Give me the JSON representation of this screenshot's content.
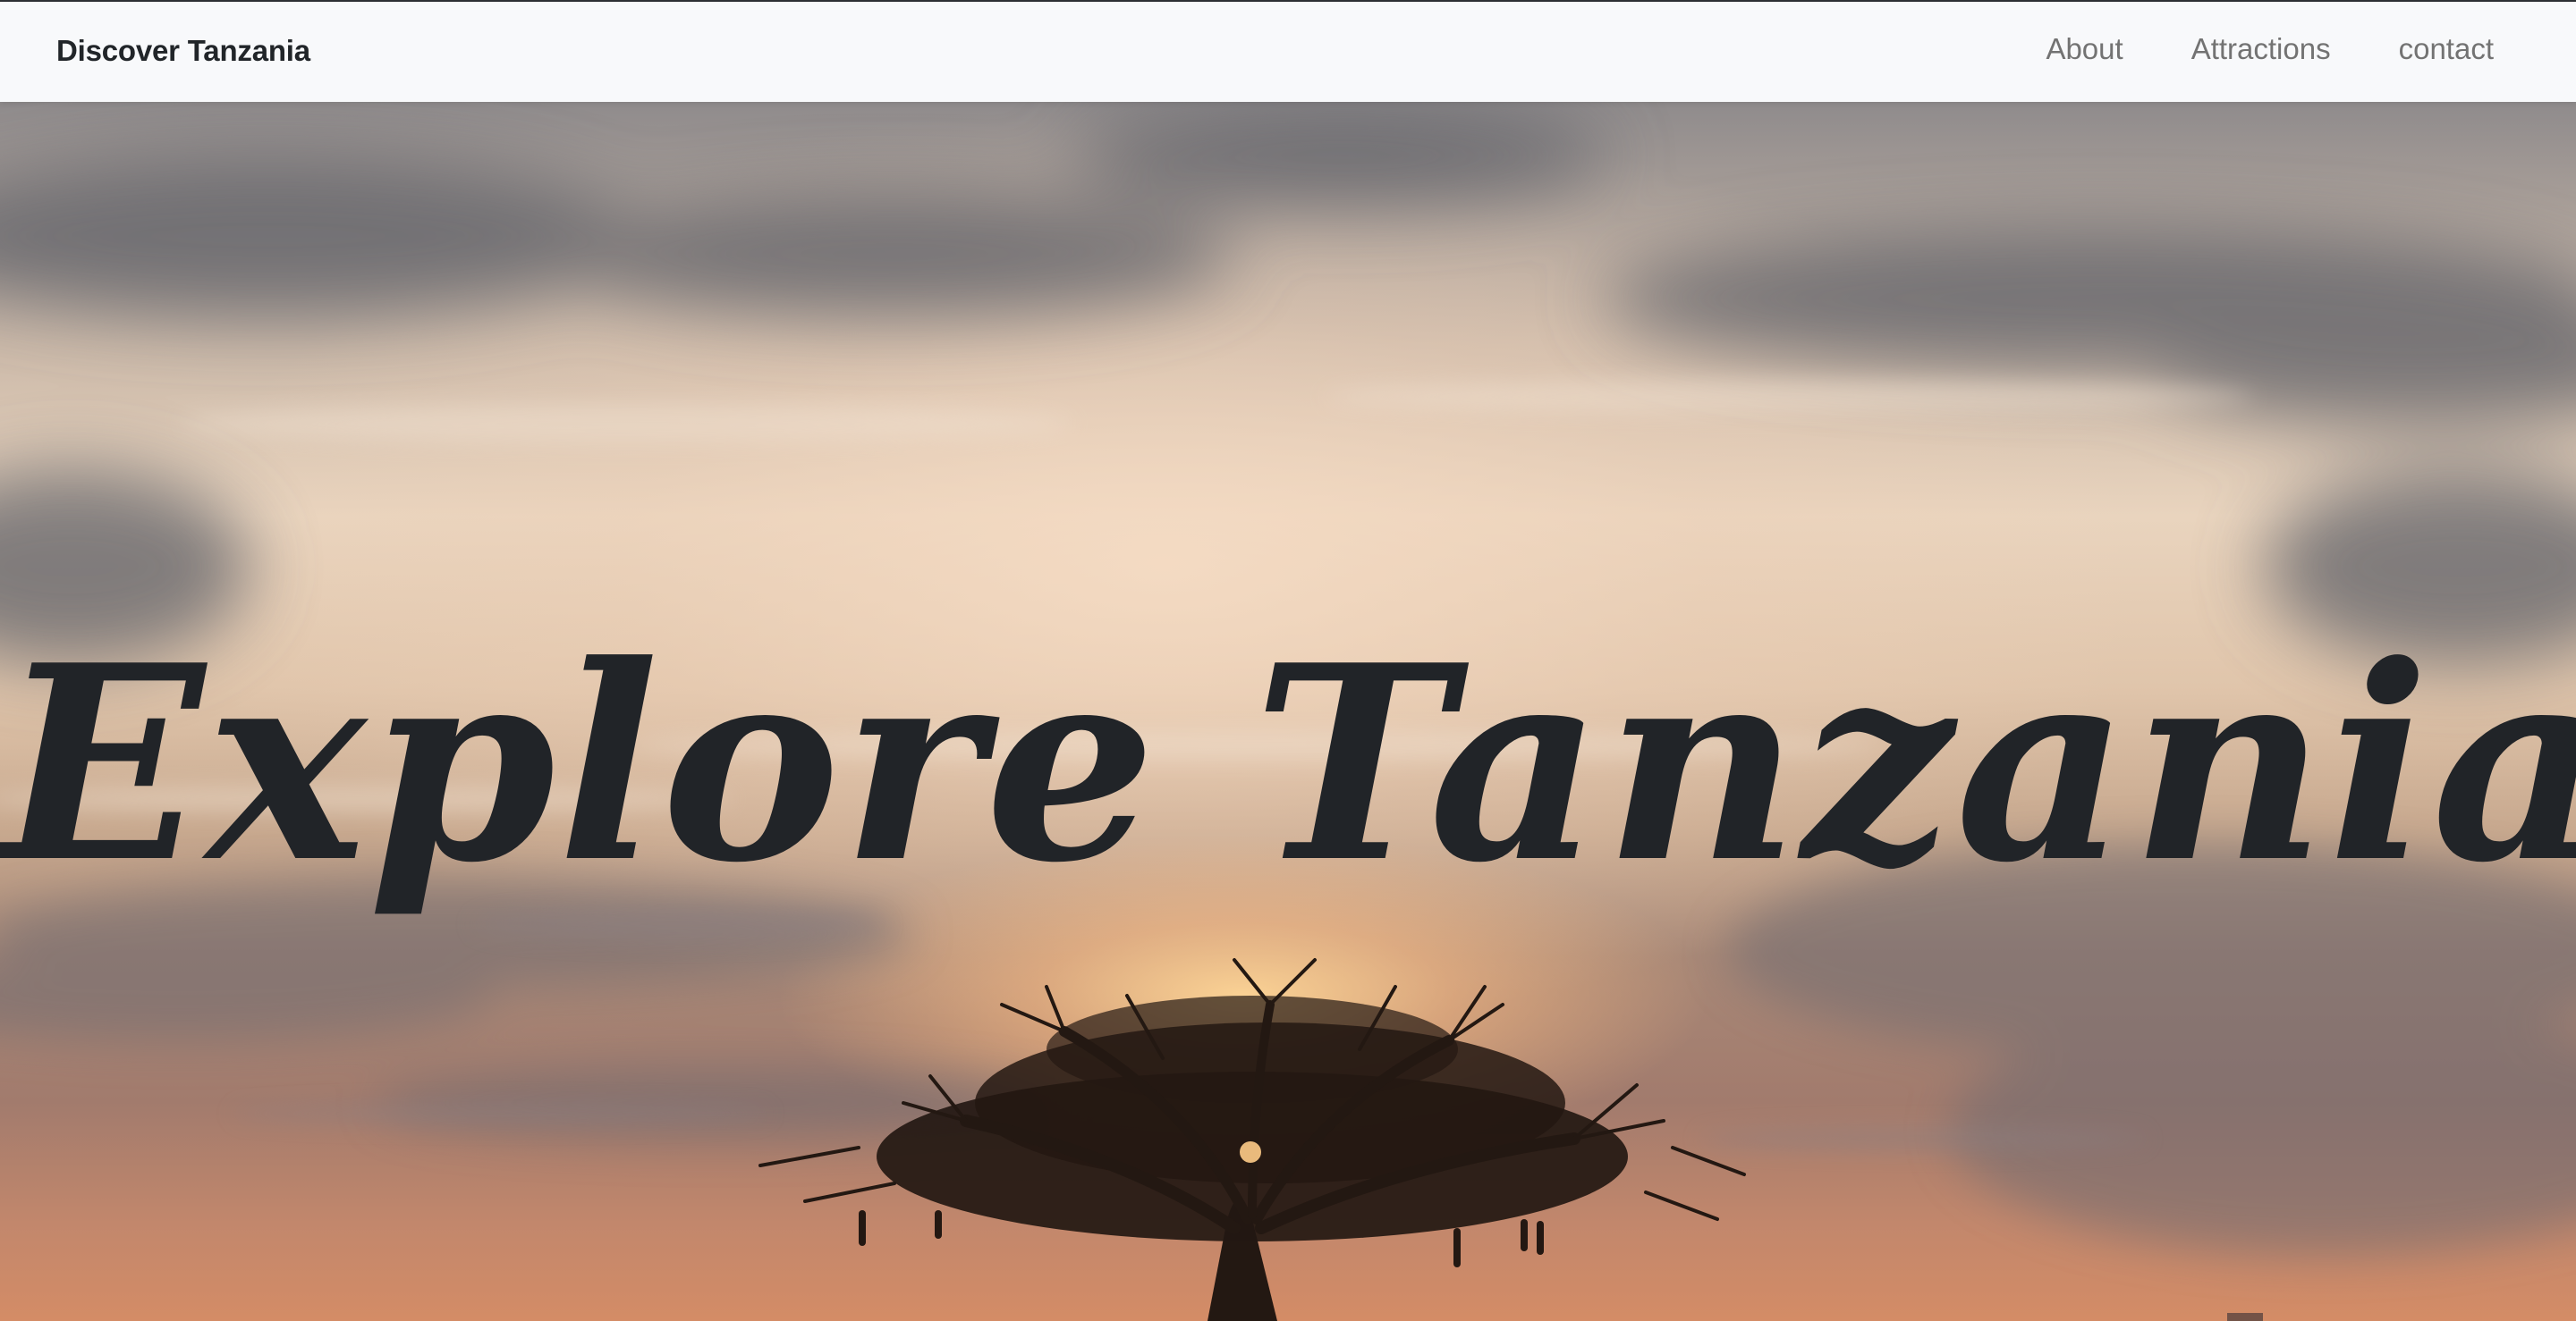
{
  "navbar": {
    "brand": "Discover Tanzania",
    "links": [
      "About",
      "Attractions",
      "contact"
    ]
  },
  "hero": {
    "title": "Explore Tanzania",
    "background": "sunset-sky-with-baobab-tree-photo"
  },
  "colors": {
    "navbar_bg": "#f8f9fb",
    "brand_text": "#212529",
    "nav_link": "#737373",
    "title_text": "#212428"
  }
}
